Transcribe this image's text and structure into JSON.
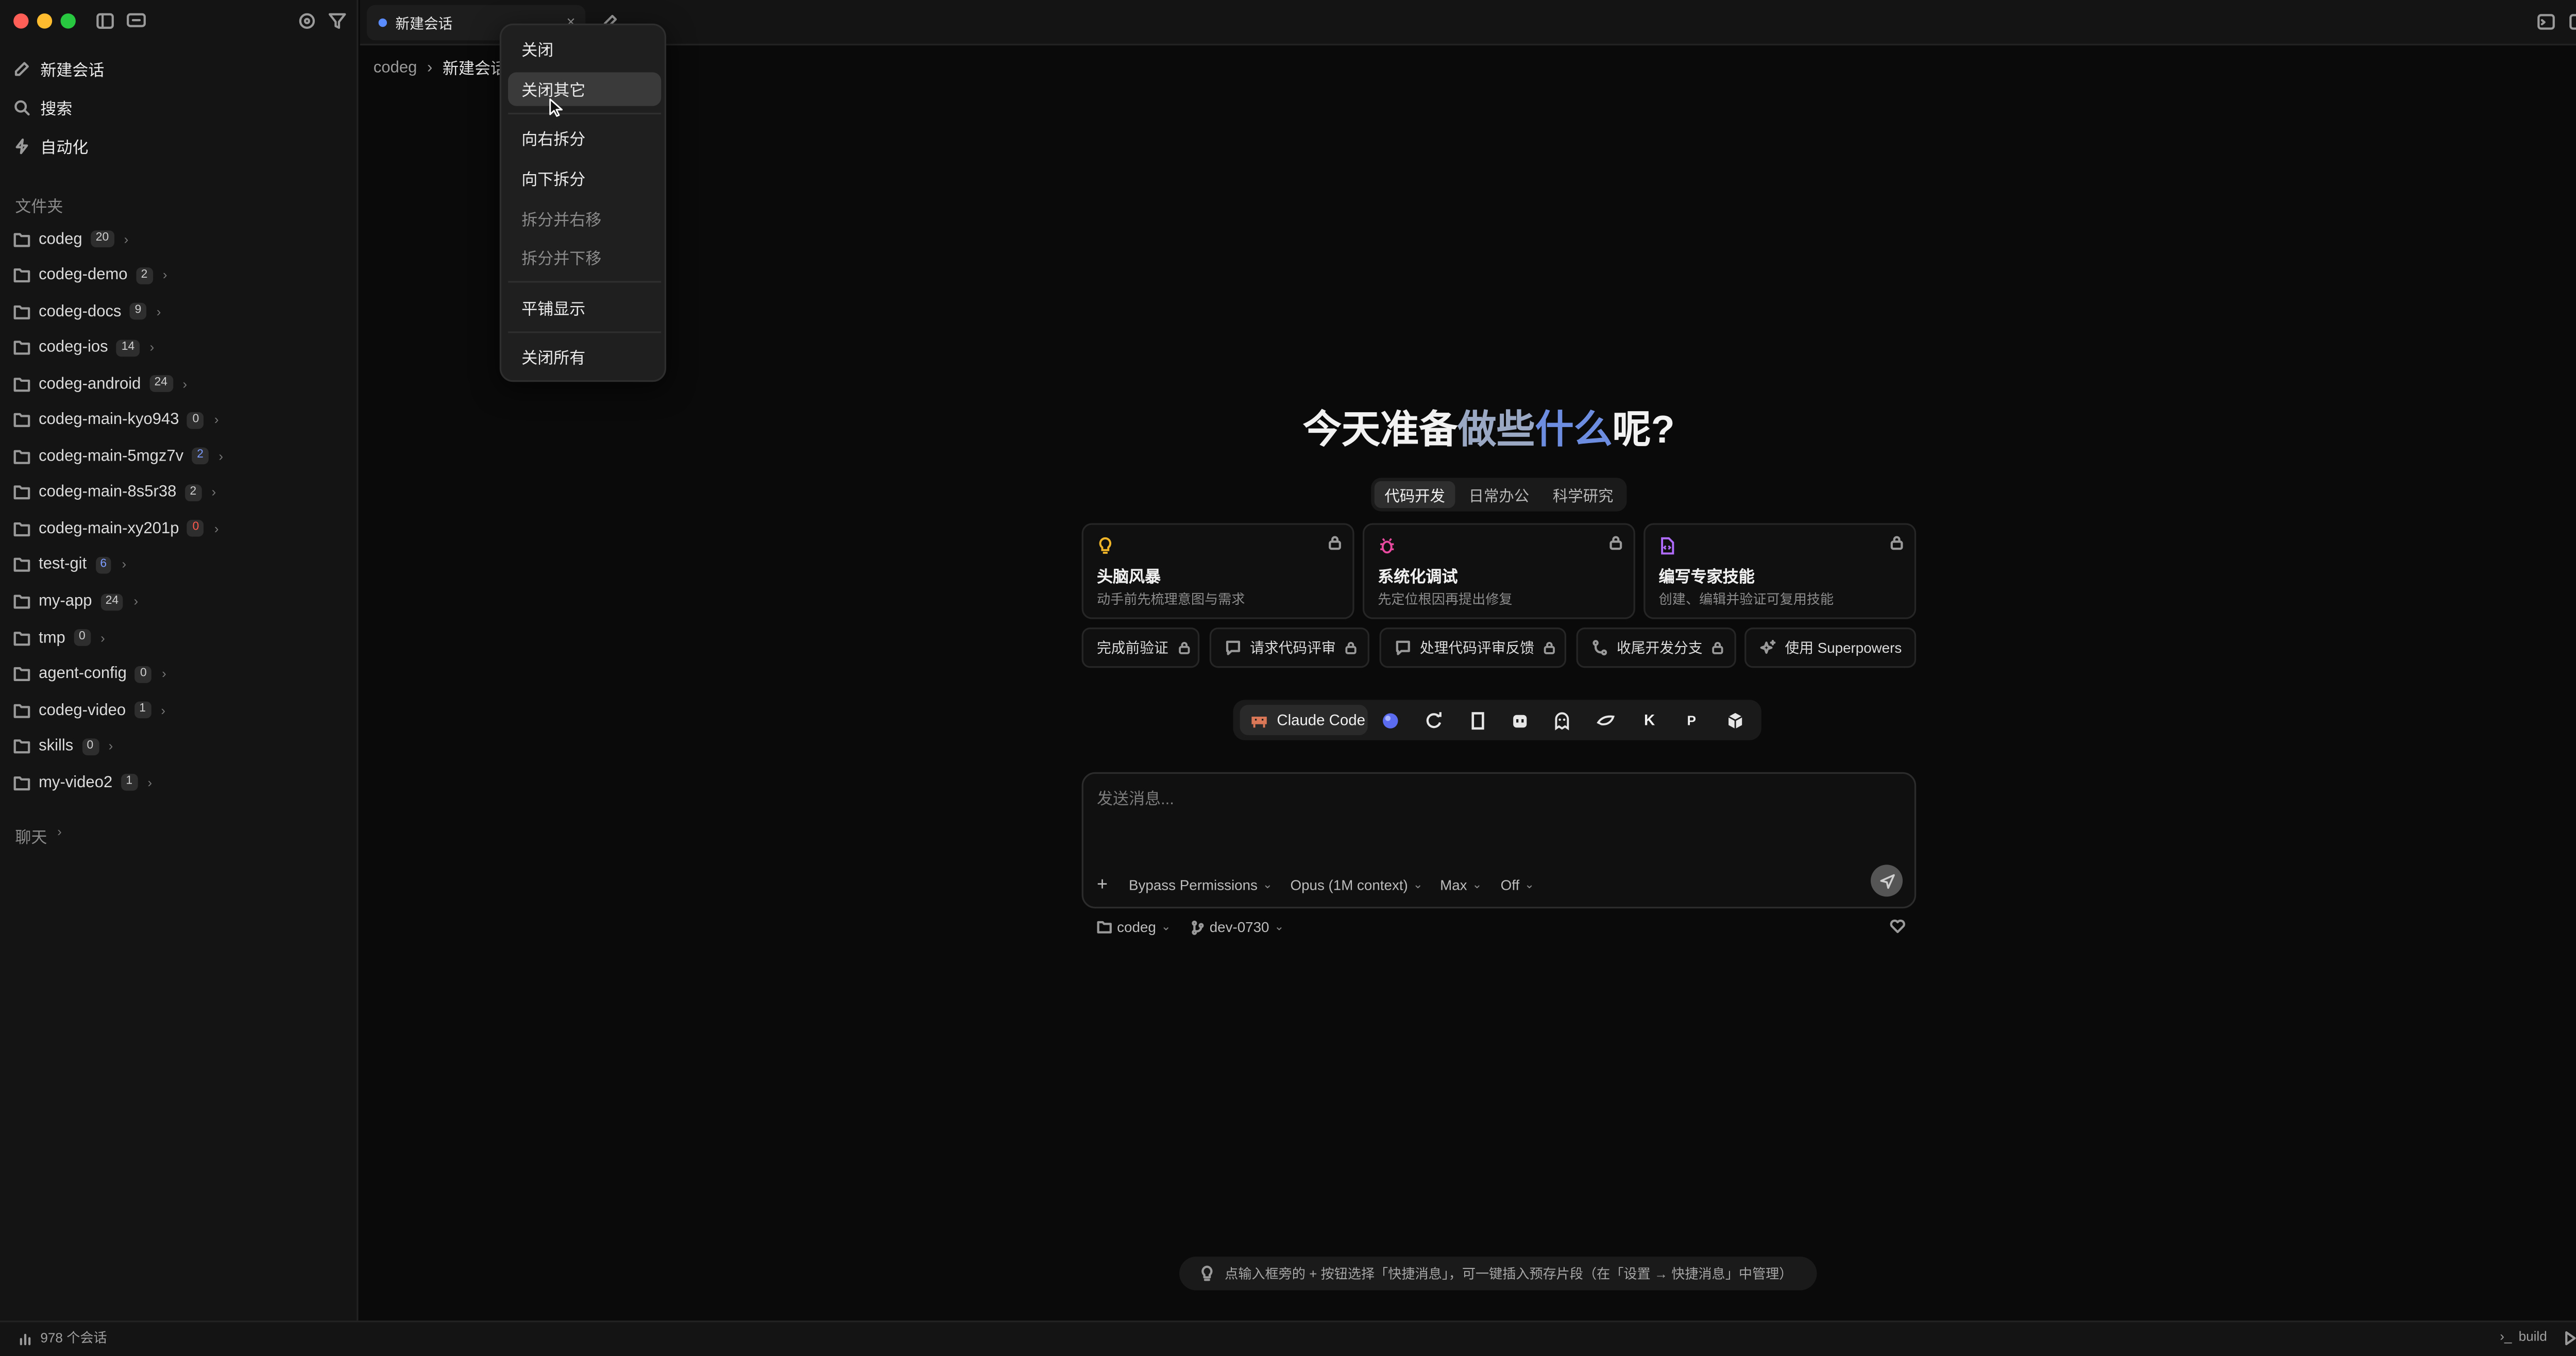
{
  "window": {
    "traffic_colors": [
      "#ff5f57",
      "#febc2e",
      "#28c840"
    ]
  },
  "sidebar": {
    "nav": [
      {
        "label": "新建会话",
        "icon": "edit-icon"
      },
      {
        "label": "搜索",
        "icon": "search-icon"
      },
      {
        "label": "自动化",
        "icon": "bolt-icon"
      }
    ],
    "folders_label": "文件夹",
    "folders": [
      {
        "name": "codeg",
        "count": "20"
      },
      {
        "name": "codeg-demo",
        "count": "2"
      },
      {
        "name": "codeg-docs",
        "count": "9"
      },
      {
        "name": "codeg-ios",
        "count": "14"
      },
      {
        "name": "codeg-android",
        "count": "24"
      },
      {
        "name": "codeg-main-kyo943",
        "count": "0"
      },
      {
        "name": "codeg-main-5mgz7v",
        "count": "2"
      },
      {
        "name": "codeg-main-8s5r38",
        "count": "2"
      },
      {
        "name": "codeg-main-xy201p",
        "count": "0"
      },
      {
        "name": "test-git",
        "count": "6"
      },
      {
        "name": "my-app",
        "count": "24"
      },
      {
        "name": "tmp",
        "count": "0"
      },
      {
        "name": "agent-config",
        "count": "0"
      },
      {
        "name": "codeg-video",
        "count": "1"
      },
      {
        "name": "skills",
        "count": "0"
      },
      {
        "name": "my-video2",
        "count": "1"
      }
    ],
    "chat_label": "聊天"
  },
  "tab": {
    "title": "新建会话"
  },
  "breadcrumb": {
    "root": "codeg",
    "current": "新建会话"
  },
  "context_menu": {
    "items": [
      "关闭",
      "关闭其它",
      "向右拆分",
      "向下拆分",
      "拆分并右移",
      "拆分并下移",
      "平铺显示",
      "关闭所有"
    ]
  },
  "main": {
    "heading": {
      "a": "今天准备",
      "b": "做些",
      "c": "什么",
      "d": "呢?"
    },
    "mode_tabs": [
      "代码开发",
      "日常办公",
      "科学研究"
    ],
    "cards": [
      {
        "title": "头脑风暴",
        "subtitle": "动手前先梳理意图与需求",
        "icon": "lightbulb-icon",
        "color": "#f0b429"
      },
      {
        "title": "系统化调试",
        "subtitle": "先定位根因再提出修复",
        "icon": "bug-icon",
        "color": "#e84aa0"
      },
      {
        "title": "编写专家技能",
        "subtitle": "创建、编辑并验证可复用技能",
        "icon": "file-code-icon",
        "color": "#b06bff"
      }
    ],
    "chips": [
      "完成前验证",
      "请求代码评审",
      "处理代码评审反馈",
      "收尾开发分支",
      "使用 Superpowers"
    ],
    "agent_active": "Claude Code",
    "composer": {
      "placeholder": "发送消息...",
      "permissions": "Bypass Permissions",
      "model": "Opus (1M context)",
      "effort": "Max",
      "thinking": "Off"
    },
    "folder": "codeg",
    "branch": "dev-0730",
    "tip": "点输入框旁的 + 按钮选择「快捷消息」，可一键插入预存片段（在「设置 → 快捷消息」中管理）"
  },
  "status": {
    "sessions": "978 个会话",
    "build": "build"
  }
}
